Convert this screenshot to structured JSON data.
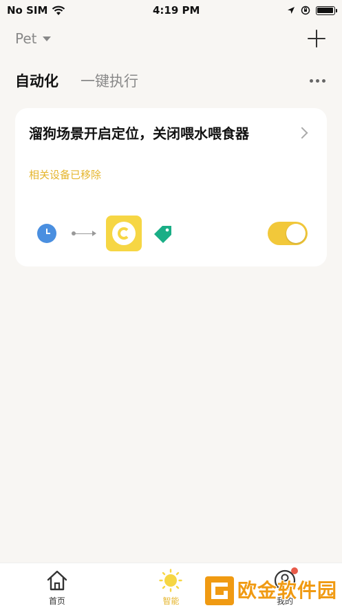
{
  "status_bar": {
    "carrier": "No SIM",
    "time": "4:19 PM"
  },
  "header": {
    "home_name": "Pet"
  },
  "tabs": [
    {
      "label": "自动化",
      "active": true
    },
    {
      "label": "一键执行",
      "active": false
    }
  ],
  "card": {
    "title": "溜狗场景开启定位，关闭喂水喂食器",
    "subtitle": "相关设备已移除",
    "enabled": true
  },
  "bottom_nav": [
    {
      "label": "首页",
      "icon": "home-icon",
      "active": false
    },
    {
      "label": "智能",
      "icon": "sun-icon",
      "active": true
    },
    {
      "label": "我的",
      "icon": "user-icon",
      "active": false
    }
  ],
  "watermark": {
    "text": "欧金软件园",
    "url": "www.ouyaoxiazai.com"
  },
  "colors": {
    "accent": "#f2c83a",
    "subtitle": "#e5b52c",
    "clock": "#4a8fe0",
    "tag": "#1aae86",
    "background": "#f8f6f3"
  }
}
